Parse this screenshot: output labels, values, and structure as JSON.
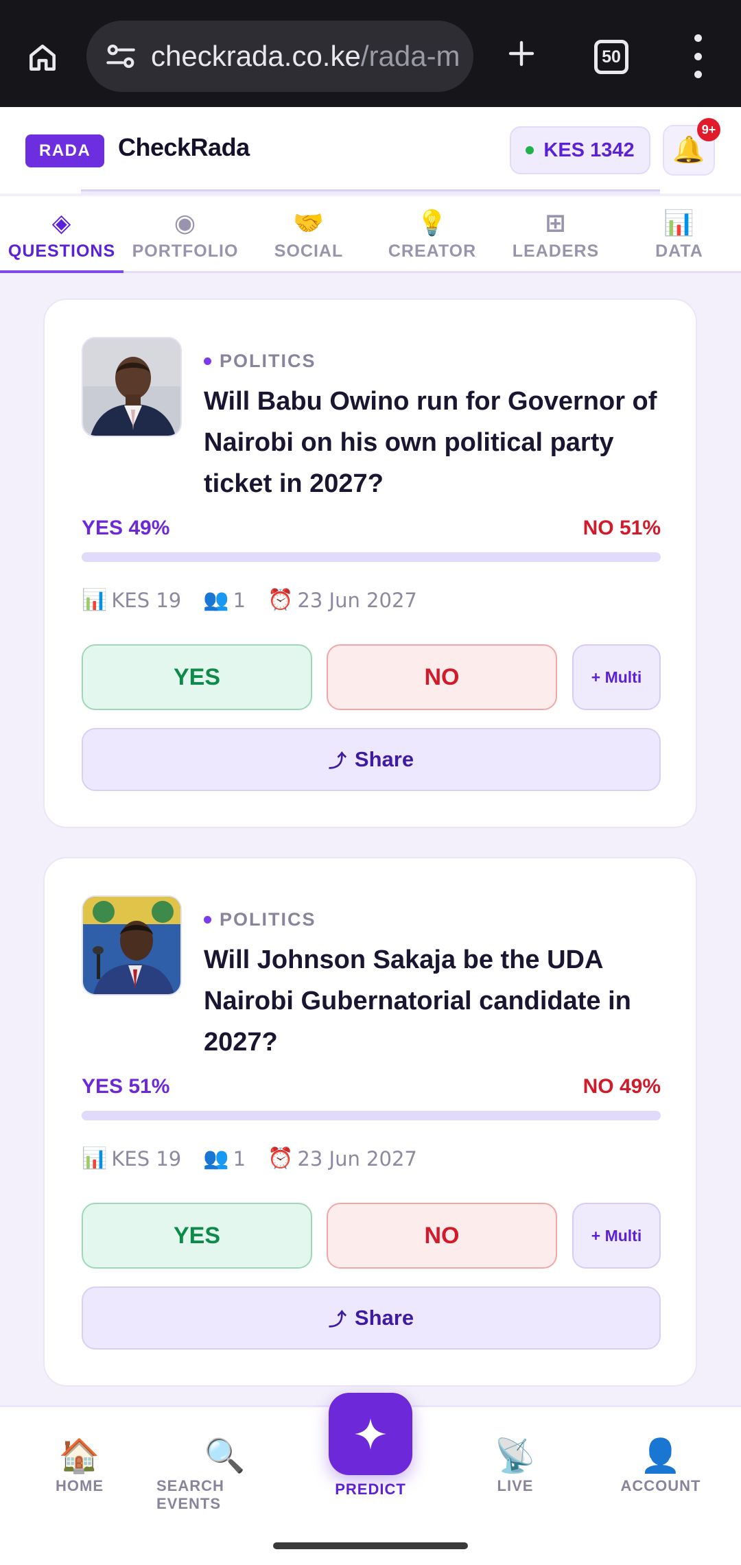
{
  "browser": {
    "url_host": "checkrada.co.ke",
    "url_path": "/rada-m",
    "tab_count": "50"
  },
  "header": {
    "badge": "RADA",
    "brand": "CheckRada",
    "balance": "KES 1342",
    "notifications": "9+"
  },
  "tabs": [
    {
      "label": "QUESTIONS",
      "icon": "◈",
      "active": true
    },
    {
      "label": "PORTFOLIO",
      "icon": "◉",
      "active": false
    },
    {
      "label": "SOCIAL",
      "icon": "🤝",
      "active": false
    },
    {
      "label": "CREATOR",
      "icon": "💡",
      "active": false
    },
    {
      "label": "LEADERS",
      "icon": "⊞",
      "active": false
    },
    {
      "label": "DATA",
      "icon": "📊",
      "active": false
    }
  ],
  "questions": [
    {
      "category": "POLITICS",
      "title": "Will Babu Owino run for Governor of Nairobi on his own political party ticket in 2027?",
      "yes_label": "YES 49%",
      "no_label": "NO 51%",
      "yes_fraction": 0.49,
      "volume": "KES 19",
      "participants": "1",
      "deadline": "23 Jun 2027",
      "yes_button": "YES",
      "no_button": "NO",
      "multi_button": "+ Multi",
      "share_button": "Share"
    },
    {
      "category": "POLITICS",
      "title": "Will Johnson Sakaja be the UDA Nairobi Gubernatorial candidate in 2027?",
      "yes_label": "YES 51%",
      "no_label": "NO 49%",
      "yes_fraction": 0.51,
      "volume": "KES 19",
      "participants": "1",
      "deadline": "23 Jun 2027",
      "yes_button": "YES",
      "no_button": "NO",
      "multi_button": "+ Multi",
      "share_button": "Share"
    }
  ],
  "icons": {
    "volume": "📊",
    "participants": "👥",
    "deadline": "⏰",
    "share": "⤴"
  },
  "bottom_nav": {
    "home": {
      "label": "HOME",
      "icon": "🏠"
    },
    "search": {
      "label": "SEARCH EVENTS",
      "icon": "🔍"
    },
    "predict": {
      "label": "PREDICT"
    },
    "live": {
      "label": "LIVE",
      "icon": "📡"
    },
    "account": {
      "label": "ACCOUNT",
      "icon": "👤"
    }
  },
  "colors": {
    "accent": "#6d28d9",
    "yes": "#0e8a4a",
    "no": "#d11a2a"
  }
}
